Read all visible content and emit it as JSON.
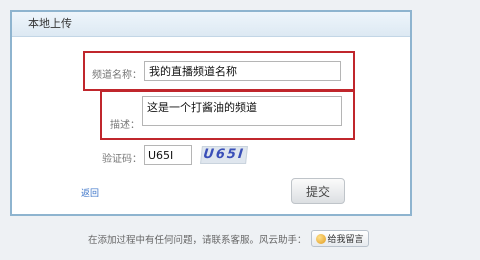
{
  "panel": {
    "title": "本地上传"
  },
  "form": {
    "channel_label": "频道名称：",
    "channel_value": "我的直播频道名称",
    "desc_label": "描述：",
    "desc_value": "这是一个打酱油的频道",
    "captcha_label": "验证码：",
    "captcha_value": "U65I",
    "captcha_image_text": "U65I",
    "back_label": "返回",
    "submit_label": "提交"
  },
  "footer": {
    "text": "在添加过程中有任何问题，请联系客服。风云助手：",
    "message_button_label": "给我留言"
  },
  "colors": {
    "highlight": "#c0262c",
    "panel_border": "#8eb4cf",
    "link": "#3a73c8"
  }
}
